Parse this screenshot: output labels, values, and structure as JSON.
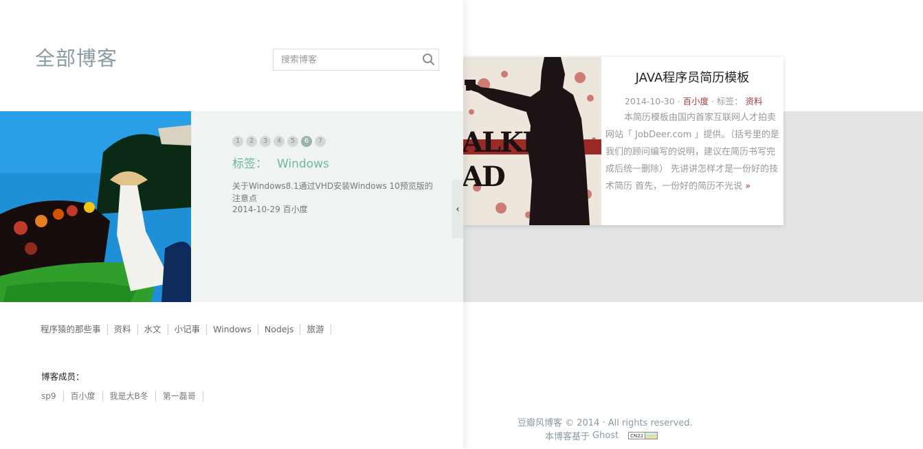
{
  "blog": {
    "title": "全部博客"
  },
  "search": {
    "placeholder": "搜索博客"
  },
  "featured": {
    "pages": [
      "1",
      "2",
      "3",
      "4",
      "5",
      "6",
      "7"
    ],
    "active_page": "6",
    "tag_label": "标签：",
    "tag_value": "Windows",
    "post_title": "关于Windows8.1通过VHD安装Windows 10预览版的注意点",
    "post_date": "2014-10-29",
    "post_author": "百小度"
  },
  "categories": [
    "程序猿的那些事",
    "资料",
    "水文",
    "小记事",
    "Windows",
    "Nodejs",
    "旅游"
  ],
  "members": {
    "heading": "博客成员：",
    "items": [
      "sp9",
      "百小度",
      "我是大B冬",
      "第一磊哥"
    ]
  },
  "collapse": {
    "glyph": "‹"
  },
  "card": {
    "title": "JAVA程序员简历模板",
    "date": "2014-10-30",
    "sep": " · ",
    "author": "百小度",
    "tag_label": "标签：",
    "tag": "资料",
    "excerpt": "本简历模板由国内首家互联网人才拍卖网站「 JobDeer.com 」提供。（括号里的是我们的顾问编写的说明，建议在简历书写完成后统一删除） 先讲讲怎样才是一份好的技术简历 首先，一份好的简历不光说",
    "more": "»"
  },
  "footer": {
    "copyright": "豆瓣风博客 © 2014 · All rights reserved.",
    "powered_prefix": "本博客基于",
    "powered_link": "Ghost",
    "badge_text": "CN22"
  },
  "colors": {
    "title_gray": "#8a9ba4",
    "tag_green": "#71b69a",
    "accent_red": "#a33a3a",
    "feature_bg": "#eff4f2",
    "band_bg": "#e2e5e3"
  },
  "icons": {
    "search": "search-icon",
    "collapse": "chevron-left-icon"
  }
}
